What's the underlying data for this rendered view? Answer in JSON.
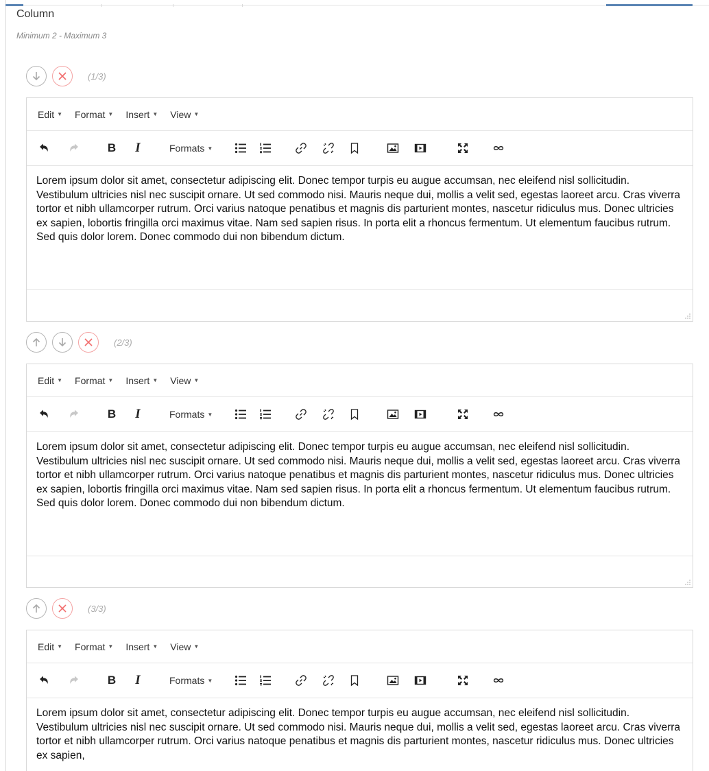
{
  "field": {
    "label": "Column",
    "hint": "Minimum 2 - Maximum 3"
  },
  "menu": [
    "Edit",
    "Format",
    "Insert",
    "View"
  ],
  "toolbar": {
    "formats_label": "Formats"
  },
  "icons": {
    "undo": "undo-icon",
    "redo": "redo-icon",
    "bold": "bold-icon",
    "italic": "italic-icon",
    "bullet_list": "bullet-list-icon",
    "numbered_list": "numbered-list-icon",
    "link": "link-icon",
    "unlink": "unlink-icon",
    "bookmark": "bookmark-icon",
    "image": "image-icon",
    "media": "media-icon",
    "fullscreen": "fullscreen-icon",
    "anchor": "anchor-icon",
    "move_up": "arrow-up-circle-icon",
    "move_down": "arrow-down-circle-icon",
    "remove": "remove-circle-icon"
  },
  "colors": {
    "accent": "#5a84b4",
    "remove": "#f26d6d",
    "muted": "#b5b5b5"
  },
  "items": [
    {
      "counter": "(1/3)",
      "content": "Lorem ipsum dolor sit amet, consectetur adipiscing elit. Donec tempor turpis eu augue accumsan, nec eleifend nisl sollicitudin. Vestibulum ultricies nisl nec suscipit ornare. Ut sed commodo nisi. Mauris neque dui, mollis a velit sed, egestas laoreet arcu. Cras viverra tortor et nibh ullamcorper rutrum. Orci varius natoque penatibus et magnis dis parturient montes, nascetur ridiculus mus. Donec ultricies ex sapien, lobortis fringilla orci maximus vitae. Nam sed sapien risus. In porta elit a rhoncus fermentum. Ut elementum faucibus rutrum. Sed quis dolor lorem. Donec commodo dui non bibendum dictum."
    },
    {
      "counter": "(2/3)",
      "content": "Lorem ipsum dolor sit amet, consectetur adipiscing elit. Donec tempor turpis eu augue accumsan, nec eleifend nisl sollicitudin. Vestibulum ultricies nisl nec suscipit ornare. Ut sed commodo nisi. Mauris neque dui, mollis a velit sed, egestas laoreet arcu. Cras viverra tortor et nibh ullamcorper rutrum. Orci varius natoque penatibus et magnis dis parturient montes, nascetur ridiculus mus. Donec ultricies ex sapien, lobortis fringilla orci maximus vitae. Nam sed sapien risus. In porta elit a rhoncus fermentum. Ut elementum faucibus rutrum. Sed quis dolor lorem. Donec commodo dui non bibendum dictum."
    },
    {
      "counter": "(3/3)",
      "content": "Lorem ipsum dolor sit amet, consectetur adipiscing elit. Donec tempor turpis eu augue accumsan, nec eleifend nisl sollicitudin. Vestibulum ultricies nisl nec suscipit ornare. Ut sed commodo nisi. Mauris neque dui, mollis a velit sed, egestas laoreet arcu. Cras viverra tortor et nibh ullamcorper rutrum. Orci varius natoque penatibus et magnis dis parturient montes, nascetur ridiculus mus. Donec ultricies ex sapien,"
    }
  ]
}
